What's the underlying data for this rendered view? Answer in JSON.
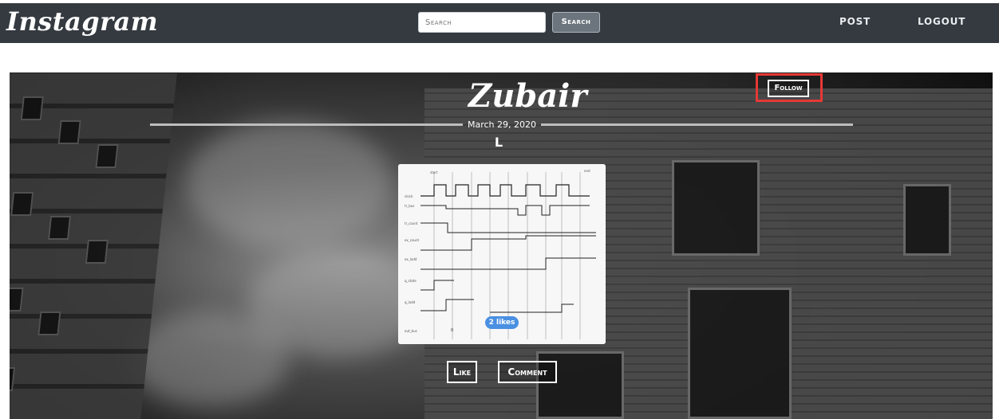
{
  "navbar": {
    "brand": "Instagram",
    "search": {
      "placeholder": "Search",
      "button_label": "Search"
    },
    "links": [
      "POST",
      "LOGOUT"
    ]
  },
  "post": {
    "username": "Zubair",
    "follow_label": "Follow",
    "date": "March 29, 2020",
    "caption": "L",
    "image_icon": "timing-diagram-image",
    "likes_label": "2 likes",
    "like_label": "Like",
    "comment_label": "Comment"
  },
  "colors": {
    "navbar": "#343a40",
    "likes_badge": "#4a90e2",
    "highlight": "#e53935"
  }
}
